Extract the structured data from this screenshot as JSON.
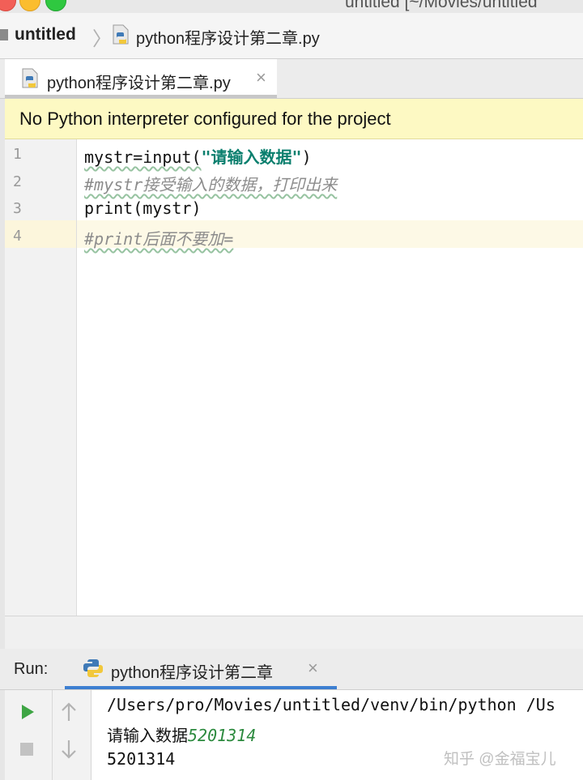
{
  "window": {
    "title": "untitled [~/Movies/untitled"
  },
  "navbar": {
    "project": "untitled",
    "file": "python程序设计第二章.py"
  },
  "editor_tab": {
    "label": "python程序设计第二章.py"
  },
  "banner": {
    "text": "No Python interpreter configured for the project"
  },
  "gutter": {
    "lines": [
      "1",
      "2",
      "3",
      "4"
    ]
  },
  "code": {
    "line1_a": "mystr=input(",
    "line1_str": "\"请输入数据\"",
    "line1_b": ")",
    "line2": "#mystr接受输入的数据，打印出来",
    "line3": "print(mystr)",
    "line4": "#print后面不要加="
  },
  "run": {
    "label": "Run:",
    "tab_label": "python程序设计第二章"
  },
  "console": {
    "line1": "/Users/pro/Movies/untitled/venv/bin/python /Us",
    "prompt": "请输入数据",
    "echo": "5201314",
    "output": "5201314"
  },
  "watermark": {
    "text": "知乎 @金福宝儿"
  },
  "icons": [
    "python-file-icon",
    "close-icon",
    "python-icon",
    "play-icon",
    "stop-icon",
    "arrow-up-icon",
    "arrow-down-icon"
  ],
  "colors": {
    "banner_bg": "#fdf9c3",
    "string": "#0a7f6e",
    "comment": "#8c8c8c",
    "echo": "#2c8a3e",
    "run_tab_underline": "#3d7fd1"
  }
}
